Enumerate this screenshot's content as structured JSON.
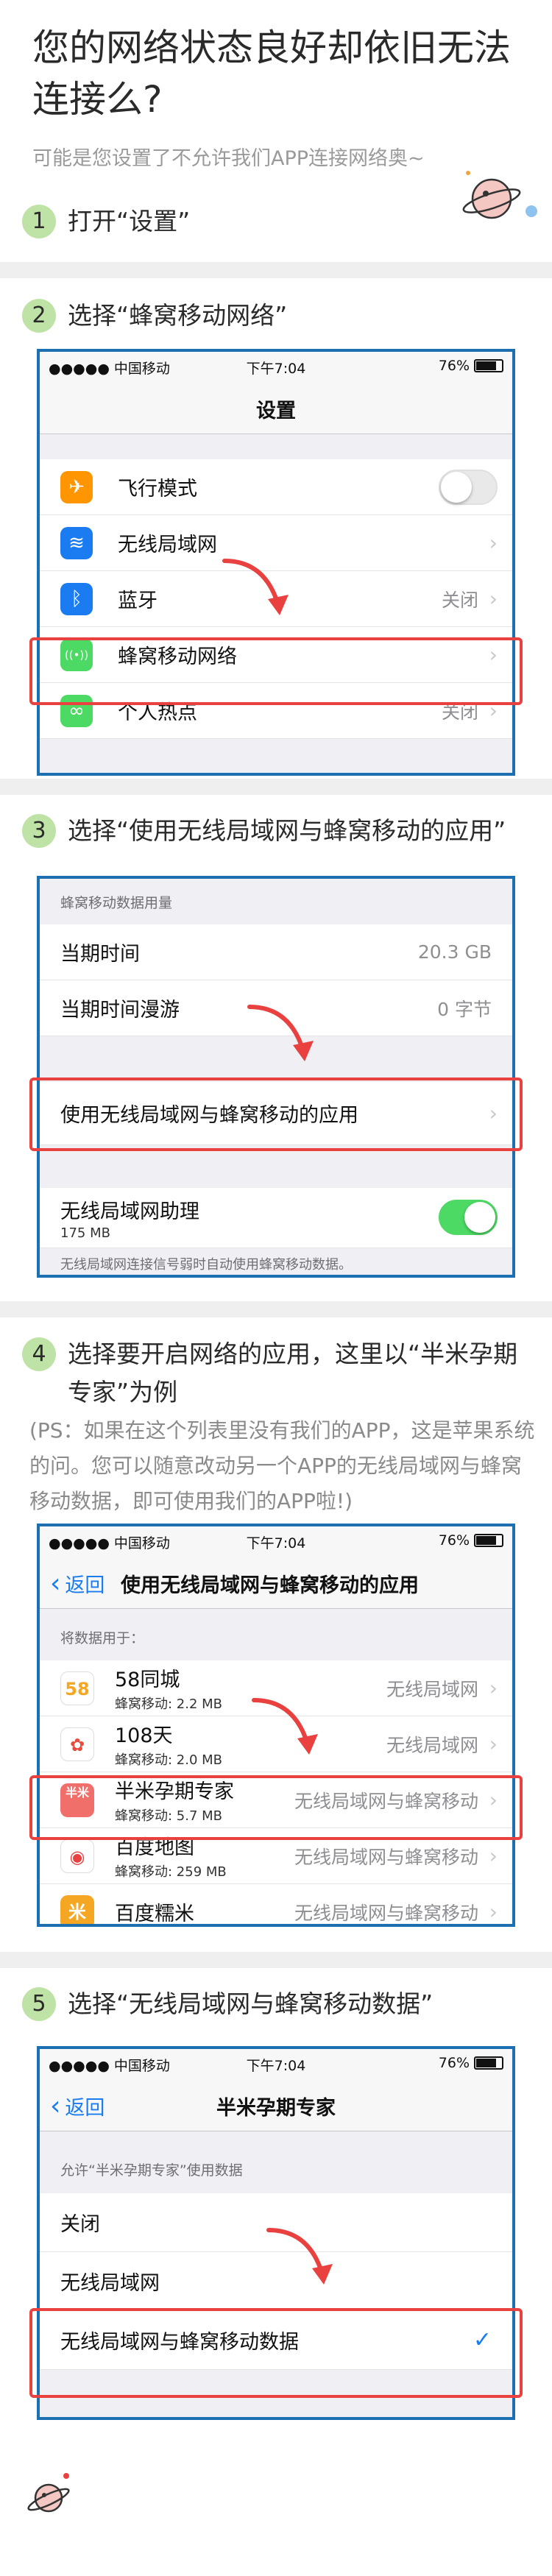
{
  "header": {
    "title": "您的网络状态良好却依旧无法连接么?",
    "subtitle": "可能是您设置了不允许我们APP连接网络奥~"
  },
  "steps": [
    {
      "num": "1",
      "text": "打开“设置”"
    },
    {
      "num": "2",
      "text": "选择“蜂窝移动网络”"
    },
    {
      "num": "3",
      "text": "选择“使用无线局域网与蜂窝移动的应用”"
    },
    {
      "num": "4",
      "text": "选择要开启网络的应用，这里以“半米孕期专家”为例"
    },
    {
      "num": "5",
      "text": "选择“无线局域网与蜂窝移动数据”"
    }
  ],
  "note": "(PS：如果在这个列表里没有我们的APP，这是苹果系统的问。您可以随意改动另一个APP的无线局域网与蜂窝移动数据，即可使用我们的APP啦!)",
  "status": {
    "carrier": "●●●●● 中国移动",
    "wifi": "wifi-icon",
    "time": "下午7:04",
    "battery": "76%"
  },
  "screen2": {
    "title": "设置",
    "rows": [
      {
        "label": "飞行模式",
        "icon": "airplane-icon",
        "color": "#ff9500",
        "glyph": "✈"
      },
      {
        "label": "无线局域网",
        "icon": "wifi-icon",
        "color": "#1a7cf0",
        "glyph": "≋"
      },
      {
        "label": "蓝牙",
        "icon": "bluetooth-icon",
        "color": "#1a7cf0",
        "glyph": "ᛒ",
        "value": "关闭"
      },
      {
        "label": "蜂窝移动网络",
        "icon": "cellular-icon",
        "color": "#4cd964",
        "glyph": "((•))"
      },
      {
        "label": "个人热点",
        "icon": "hotspot-icon",
        "color": "#4cd964",
        "glyph": "∞",
        "value": "关闭"
      }
    ]
  },
  "screen3": {
    "section": "蜂窝移动数据用量",
    "rows": [
      {
        "label": "当期时间",
        "value": "20.3 GB"
      },
      {
        "label": "当期时间漫游",
        "value": "0 字节"
      }
    ],
    "apps_row": "使用无线局域网与蜂窝移动的应用",
    "assist_label": "无线局域网助理",
    "assist_sub": "175 MB",
    "footer": "无线局域网连接信号弱时自动使用蜂窝移动数据。"
  },
  "screen4": {
    "back": "返回",
    "title": "使用无线局域网与蜂窝移动的应用",
    "section": "将数据用于：",
    "apps": [
      {
        "name": "58同城",
        "sub": "蜂窝移动: 2.2 MB",
        "value": "无线局域网",
        "icon": "app-58-icon",
        "glyph": "58",
        "bg": "#ffffff",
        "fg": "#f5a623"
      },
      {
        "name": "108天",
        "sub": "蜂窝移动: 2.0 MB",
        "value": "无线局域网",
        "icon": "app-108-icon",
        "glyph": "✿",
        "bg": "#ffffff",
        "fg": "#e94b3c"
      },
      {
        "name": "半米孕期专家",
        "sub": "蜂窝移动: 5.7 MB",
        "value": "无线局域网与蜂窝移动",
        "icon": "app-banmi-icon",
        "glyph": "半米",
        "bg": "#f06f6a",
        "fg": "#ffffff"
      },
      {
        "name": "百度地图",
        "sub": "蜂窝移动: 259 MB",
        "value": "无线局域网与蜂窝移动",
        "icon": "app-baidumap-icon",
        "glyph": "◉",
        "bg": "#ffffff",
        "fg": "#e8413f"
      },
      {
        "name": "百度糯米",
        "sub": "",
        "value": "无线局域网与蜂窝移动",
        "icon": "app-nuomi-icon",
        "glyph": "米",
        "bg": "#f5a623",
        "fg": "#ffffff"
      }
    ]
  },
  "screen5": {
    "back": "返回",
    "title": "半米孕期专家",
    "section": "允许“半米孕期专家”使用数据",
    "options": [
      "关闭",
      "无线局域网",
      "无线局域网与蜂窝移动数据"
    ],
    "check": "✓"
  },
  "chev": "›"
}
